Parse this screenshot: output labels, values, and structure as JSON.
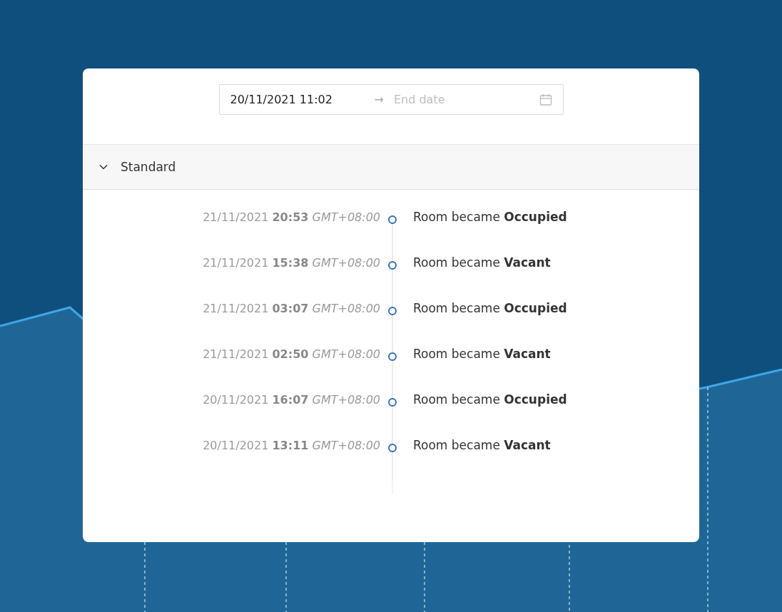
{
  "date_range": {
    "start": "20/11/2021 11:02",
    "separator": "→",
    "end_placeholder": "End date"
  },
  "section": {
    "title": "Standard",
    "expanded": true,
    "events": [
      {
        "timestamp": "21/11/2021 **20:53** *GMT+08:00*",
        "message": "Room became **Occupied**"
      },
      {
        "timestamp": "21/11/2021 **15:38** *GMT+08:00*",
        "message": "Room became **Vacant**"
      },
      {
        "timestamp": "21/11/2021 **03:07** *GMT+08:00*",
        "message": "Room became **Occupied**"
      },
      {
        "timestamp": "21/11/2021 **02:50** *GMT+08:00*",
        "message": "Room became **Vacant**"
      },
      {
        "timestamp": "20/11/2021 **16:07** *GMT+08:00*",
        "message": "Room became **Occupied**"
      },
      {
        "timestamp": "20/11/2021 **13:11** *GMT+08:00*",
        "message": "Room became **Vacant**"
      }
    ]
  }
}
